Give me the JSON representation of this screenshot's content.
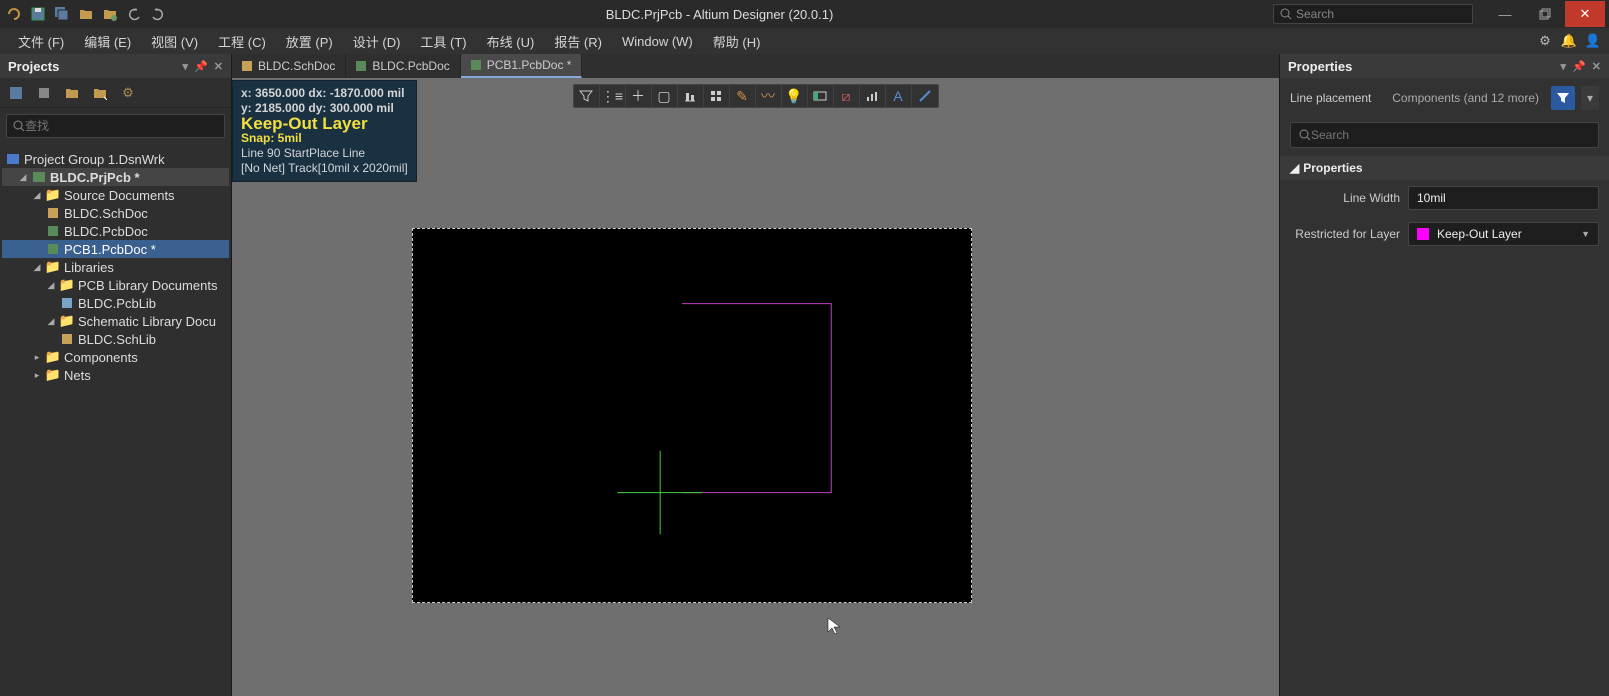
{
  "titlebar": {
    "title": "BLDC.PrjPcb - Altium Designer (20.0.1)",
    "search_placeholder": "Search"
  },
  "menubar": {
    "items": [
      "文件 (F)",
      "编辑 (E)",
      "视图 (V)",
      "工程 (C)",
      "放置 (P)",
      "设计 (D)",
      "工具 (T)",
      "布线 (U)",
      "报告 (R)",
      "Window (W)",
      "帮助 (H)"
    ]
  },
  "projects": {
    "title": "Projects",
    "search_placeholder": "查找",
    "tree": {
      "root": "Project Group 1.DsnWrk",
      "project": "BLDC.PrjPcb *",
      "source_docs_label": "Source Documents",
      "docs": [
        "BLDC.SchDoc",
        "BLDC.PcbDoc",
        "PCB1.PcbDoc *"
      ],
      "libraries_label": "Libraries",
      "pcb_lib_docs_label": "PCB Library Documents",
      "pcb_lib": "BLDC.PcbLib",
      "sch_lib_docs_label": "Schematic Library Docu",
      "sch_lib": "BLDC.SchLib",
      "components_label": "Components",
      "nets_label": "Nets"
    }
  },
  "tabs": [
    {
      "label": "BLDC.SchDoc",
      "type": "sch",
      "active": false
    },
    {
      "label": "BLDC.PcbDoc",
      "type": "pcb",
      "active": false
    },
    {
      "label": "PCB1.PcbDoc *",
      "type": "pcb",
      "active": true
    }
  ],
  "status": {
    "line1": "x:  3650.000   dx: -1870.000 mil",
    "line2": "y:  2185.000   dy:   300.000  mil",
    "layer": "Keep-Out Layer",
    "snap": "Snap: 5mil",
    "place": "Line 90 StartPlace Line",
    "track": "[No Net] Track[10mil x 2020mil]"
  },
  "properties": {
    "title": "Properties",
    "mode": "Line placement",
    "filter_text": "Components (and 12 more)",
    "search_placeholder": "Search",
    "section": "Properties",
    "line_width_label": "Line Width",
    "line_width_value": "10mil",
    "restricted_label": "Restricted for Layer",
    "restricted_value": "Keep-Out Layer",
    "restricted_color": "#ff00ff"
  }
}
